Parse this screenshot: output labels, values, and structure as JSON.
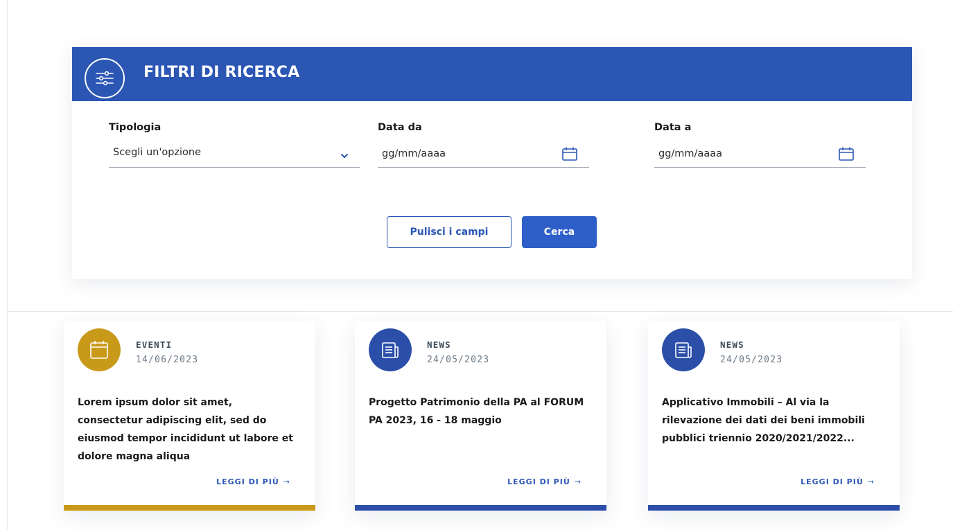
{
  "filters": {
    "title": "FILTRI DI RICERCA",
    "icon": "sliders-icon",
    "fields": [
      {
        "label": "Tipologia",
        "value": "Scegli un'opzione",
        "type": "select"
      },
      {
        "label": "Data da",
        "placeholder": "gg/mm/aaaa",
        "type": "date"
      },
      {
        "label": "Data a",
        "placeholder": "gg/mm/aaaa",
        "type": "date"
      }
    ],
    "clear_label": "Pulisci i campi",
    "search_label": "Cerca"
  },
  "cards": [
    {
      "category": "EVENTI",
      "date": "14/06/2023",
      "text": "Lorem ipsum dolor sit amet, consectetur adipiscing elit, sed do eiusmod tempor incididunt ut labore et dolore magna aliqua",
      "link": "LEGGI DI PIÙ",
      "icon": "calendar-icon",
      "color": "#c99a1a"
    },
    {
      "category": "NEWS",
      "date": "24/05/2023",
      "text": "Progetto Patrimonio della PA al FORUM PA 2023, 16 - 18 maggio",
      "link": "LEGGI DI PIÙ",
      "icon": "newspaper-icon",
      "color": "#2b4fa8"
    },
    {
      "category": "NEWS",
      "date": "24/05/2023",
      "text": "Applicativo Immobili – Al via la rilevazione dei dati dei beni immobili pubblici triennio 2020/2021/2022...",
      "link": "LEGGI DI PIÙ",
      "icon": "newspaper-icon",
      "color": "#2b4fa8"
    }
  ],
  "colors": {
    "primary": "#2b56b4",
    "events": "#c99a1a",
    "news": "#2b4fa8"
  }
}
